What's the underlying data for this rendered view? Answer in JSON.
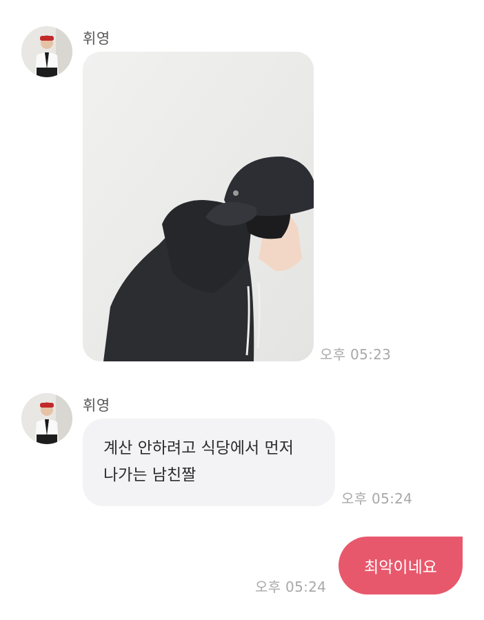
{
  "messages": [
    {
      "sender": "휘영",
      "kind": "image",
      "image_icon": "photo-person-black-hoodie-cap",
      "time": "오후 05:23"
    },
    {
      "sender": "휘영",
      "kind": "text",
      "text": "계산 안하려고 식당에서 먼저 나가는 남친짤",
      "time": "오후 05:24"
    },
    {
      "sender": "me",
      "kind": "text",
      "text": "최악이네요",
      "time": "오후 05:24"
    }
  ],
  "colors": {
    "outgoing_bubble": "#e8586c",
    "incoming_bubble": "#f3f3f5",
    "timestamp": "#a8a8a8"
  }
}
